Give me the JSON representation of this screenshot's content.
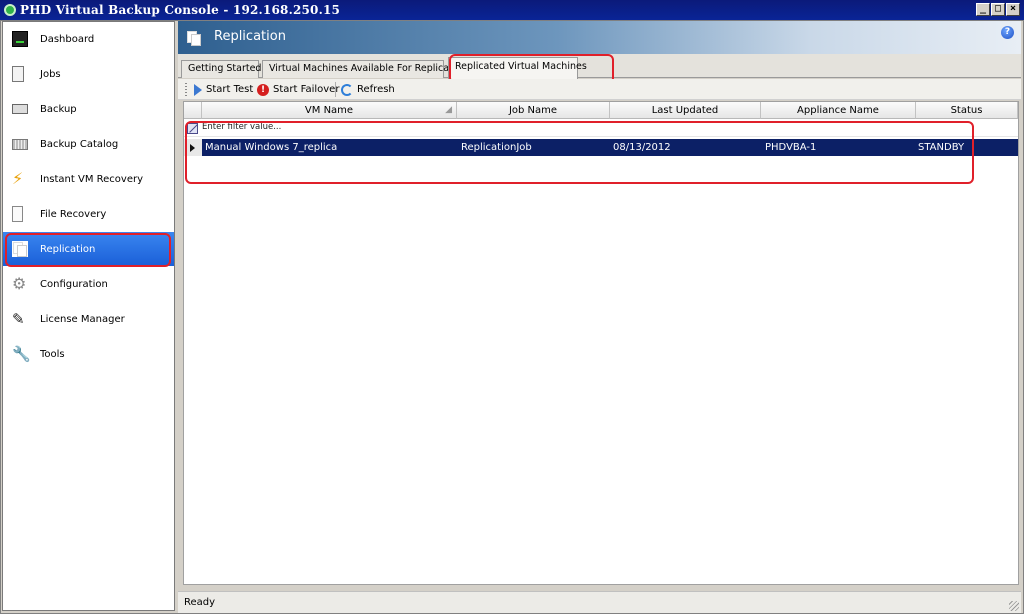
{
  "window": {
    "title": "PHD Virtual Backup Console - 192.168.250.15",
    "controls": [
      "_",
      "□",
      "×"
    ]
  },
  "sidebar": {
    "items": [
      {
        "label": "Dashboard",
        "icon": "dashboard-icon"
      },
      {
        "label": "Jobs",
        "icon": "jobs-icon"
      },
      {
        "label": "Backup",
        "icon": "backup-icon"
      },
      {
        "label": "Backup Catalog",
        "icon": "backup-catalog-icon"
      },
      {
        "label": "Instant VM Recovery",
        "icon": "lightning-icon"
      },
      {
        "label": "File Recovery",
        "icon": "file-icon"
      },
      {
        "label": "Replication",
        "icon": "replication-icon",
        "active": true
      },
      {
        "label": "Configuration",
        "icon": "gear-icon"
      },
      {
        "label": "License Manager",
        "icon": "key-icon"
      },
      {
        "label": "Tools",
        "icon": "wrench-icon"
      }
    ]
  },
  "header": {
    "title": "Replication",
    "help": "?"
  },
  "tabs": [
    {
      "label": "Getting Started"
    },
    {
      "label": "Virtual Machines Available For Replication"
    },
    {
      "label": "Replicated Virtual Machines",
      "active": true
    }
  ],
  "toolbar": {
    "start_test": "Start Test",
    "start_failover": "Start Failover",
    "refresh": "Refresh"
  },
  "grid": {
    "columns": [
      "VM Name",
      "Job Name",
      "Last Updated",
      "Appliance Name",
      "Status"
    ],
    "filter_placeholder": "Enter filter value...",
    "rows": [
      {
        "vm_name": "Manual Windows 7_replica",
        "job_name": "ReplicationJob",
        "last_updated": "08/13/2012",
        "appliance_name": "PHDVBA-1",
        "status": "STANDBY"
      }
    ]
  },
  "status_bar": {
    "text": "Ready"
  },
  "colors": {
    "title_bar": "#0a2496",
    "active_nav": "#1a5fd8",
    "selected_row": "#0c2066",
    "highlight": "#e0202a"
  }
}
